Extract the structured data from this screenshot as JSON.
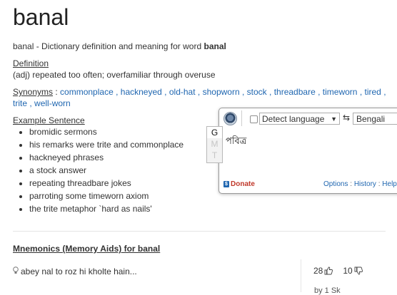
{
  "word": "banal",
  "subtitle": {
    "prefix": "banal - Dictionary definition and meaning for word ",
    "word": "banal"
  },
  "definition": {
    "label": "Definition",
    "text": "(adj) repeated too often; overfamiliar through overuse"
  },
  "synonyms": {
    "label": "Synonyms",
    "items": [
      "commonplace",
      "hackneyed",
      "old-hat",
      "shopworn",
      "stock",
      "threadbare",
      "timeworn",
      "tired",
      "trite",
      "well-worn"
    ]
  },
  "example": {
    "label": "Example Sentence",
    "items": [
      "bromidic sermons",
      "his remarks were trite and commonplace",
      "hackneyed phrases",
      "a stock answer",
      "repeating threadbare jokes",
      "parroting some timeworn axiom",
      "the trite metaphor `hard as nails'"
    ]
  },
  "mnemonics": {
    "title": "Mnemonics (Memory Aids) for banal",
    "entry": "abey nal to roz hi kholte hain...",
    "upvotes": "28",
    "downvotes": "10",
    "byline": "by 1 Sk"
  },
  "translate_popup": {
    "source_language": "Detect language",
    "target_language": "Bengali",
    "result": "পবিত্র",
    "donate_label": "Donate",
    "links": [
      "Options",
      "History",
      "Help"
    ],
    "side_tabs": [
      "G",
      "M",
      "T"
    ]
  },
  "colors": {
    "link": "#1f66b0",
    "donate": "#c0392b"
  }
}
